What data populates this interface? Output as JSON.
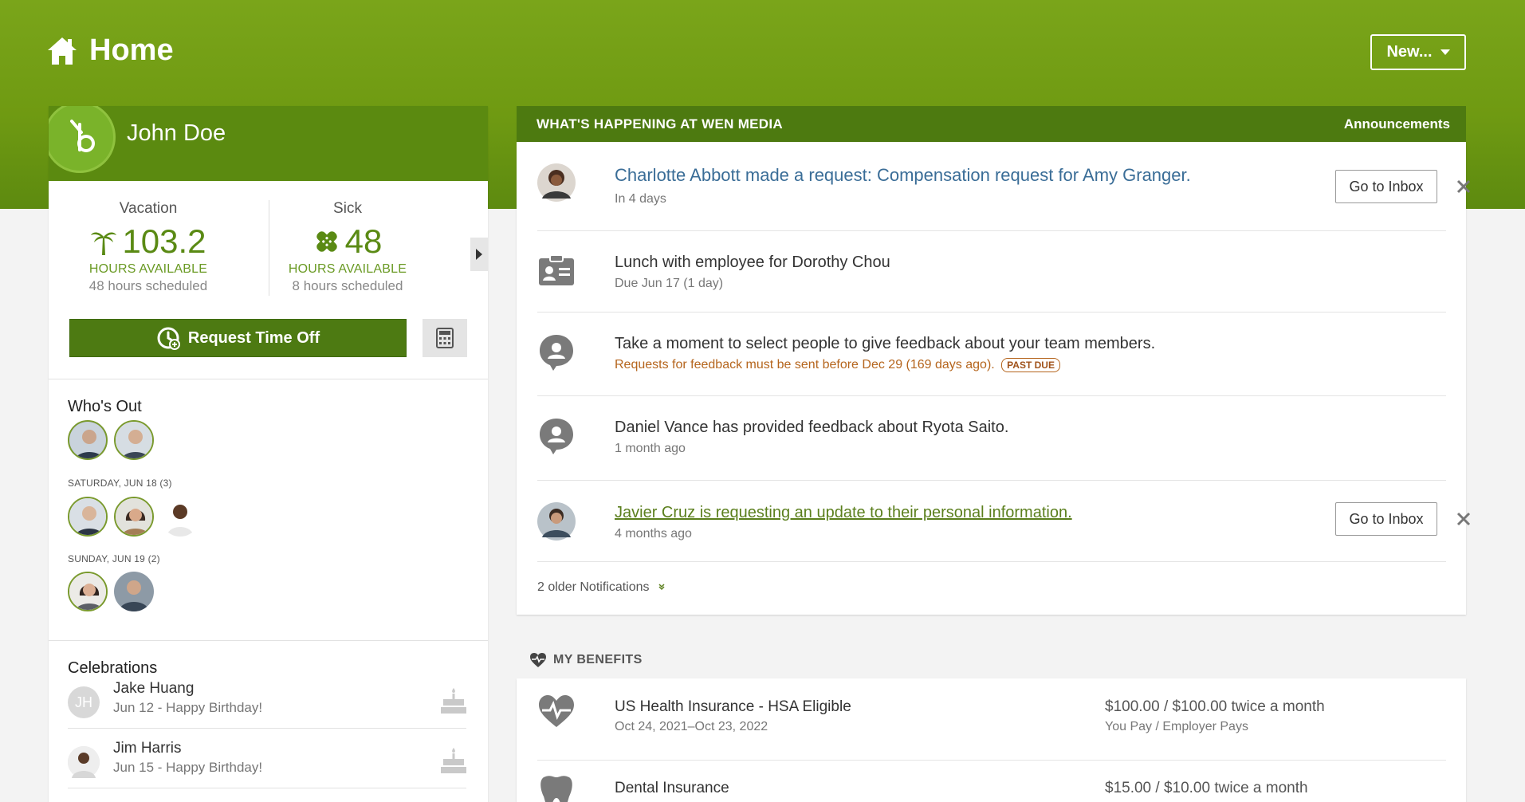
{
  "header": {
    "title": "Home",
    "new_button": "New..."
  },
  "profile": {
    "name": "John Doe"
  },
  "balances": {
    "vacation": {
      "label": "Vacation",
      "amount": "103.2",
      "unit": "HOURS AVAILABLE",
      "scheduled": "48 hours scheduled"
    },
    "sick": {
      "label": "Sick",
      "amount": "48",
      "unit": "HOURS AVAILABLE",
      "scheduled": "8 hours scheduled"
    }
  },
  "request_time_off": "Request Time Off",
  "whos_out": {
    "title": "Who's Out",
    "groups": [
      {
        "date": "SATURDAY, JUN 18 (3)"
      },
      {
        "date": "SUNDAY, JUN 19 (2)"
      }
    ]
  },
  "celebrations": {
    "title": "Celebrations",
    "items": [
      {
        "initials": "JH",
        "name": "Jake Huang",
        "detail": "Jun 12 - Happy Birthday!"
      },
      {
        "initials": "",
        "name": "Jim Harris",
        "detail": "Jun 15 - Happy Birthday!"
      }
    ]
  },
  "news": {
    "title": "WHAT'S HAPPENING AT WEN MEDIA",
    "announcements_link": "Announcements",
    "notifications": [
      {
        "title": "Charlotte Abbott made a request: Compensation request for Amy Granger.",
        "sub": "In 4 days",
        "action": "Go to Inbox"
      },
      {
        "title": "Lunch with employee for Dorothy Chou",
        "sub": "Due Jun 17 (1 day)"
      },
      {
        "title": "Take a moment to select people to give feedback about your team members.",
        "sub": "Requests for feedback must be sent before Dec 29 (169 days ago).",
        "badge": "PAST DUE"
      },
      {
        "title": "Daniel Vance has provided feedback about Ryota Saito.",
        "sub": "1 month ago"
      },
      {
        "title": "Javier Cruz is requesting an update to their personal information.",
        "sub": "4 months ago",
        "action": "Go to Inbox"
      }
    ],
    "older": "2 older Notifications"
  },
  "benefits": {
    "title": "MY BENEFITS",
    "items": [
      {
        "name": "US Health Insurance - HSA Eligible",
        "dates": "Oct 24, 2021–Oct 23, 2022",
        "cost": "$100.00 / $100.00 twice a month",
        "payers": "You Pay / Employer Pays"
      },
      {
        "name": "Dental Insurance",
        "cost": "$15.00 / $10.00 twice a month"
      }
    ]
  },
  "colors": {
    "brand_green": "#5b8a10",
    "link_blue": "#3a6d97",
    "warning": "#b5651d"
  }
}
